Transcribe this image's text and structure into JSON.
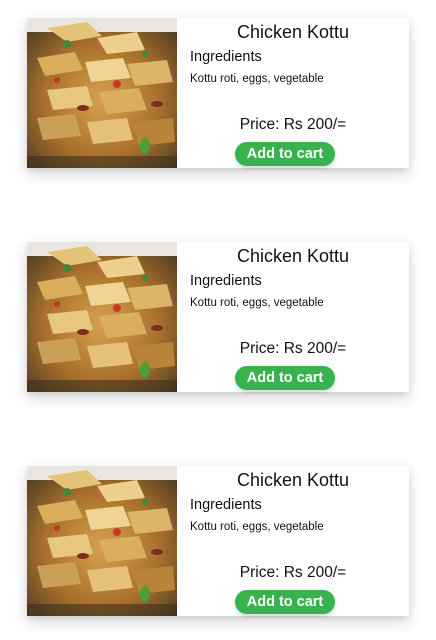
{
  "colors": {
    "button_bg": "#37b24d",
    "button_text": "#ffffff",
    "text": "#111111"
  },
  "products": [
    {
      "image_icon": "food-photo-kottu",
      "name": "Chicken Kottu",
      "ingredients_heading": "Ingredients",
      "ingredients": "Kottu roti, eggs, vegetable",
      "price": "Price: Rs 200/=",
      "button_label": "Add to cart"
    },
    {
      "image_icon": "food-photo-kottu",
      "name": "Chicken Kottu",
      "ingredients_heading": "Ingredients",
      "ingredients": "Kottu roti, eggs, vegetable",
      "price": "Price: Rs 200/=",
      "button_label": "Add to cart"
    },
    {
      "image_icon": "food-photo-kottu",
      "name": "Chicken Kottu",
      "ingredients_heading": "Ingredients",
      "ingredients": "Kottu roti, eggs, vegetable",
      "price": "Price: Rs 200/=",
      "button_label": "Add to cart"
    }
  ]
}
